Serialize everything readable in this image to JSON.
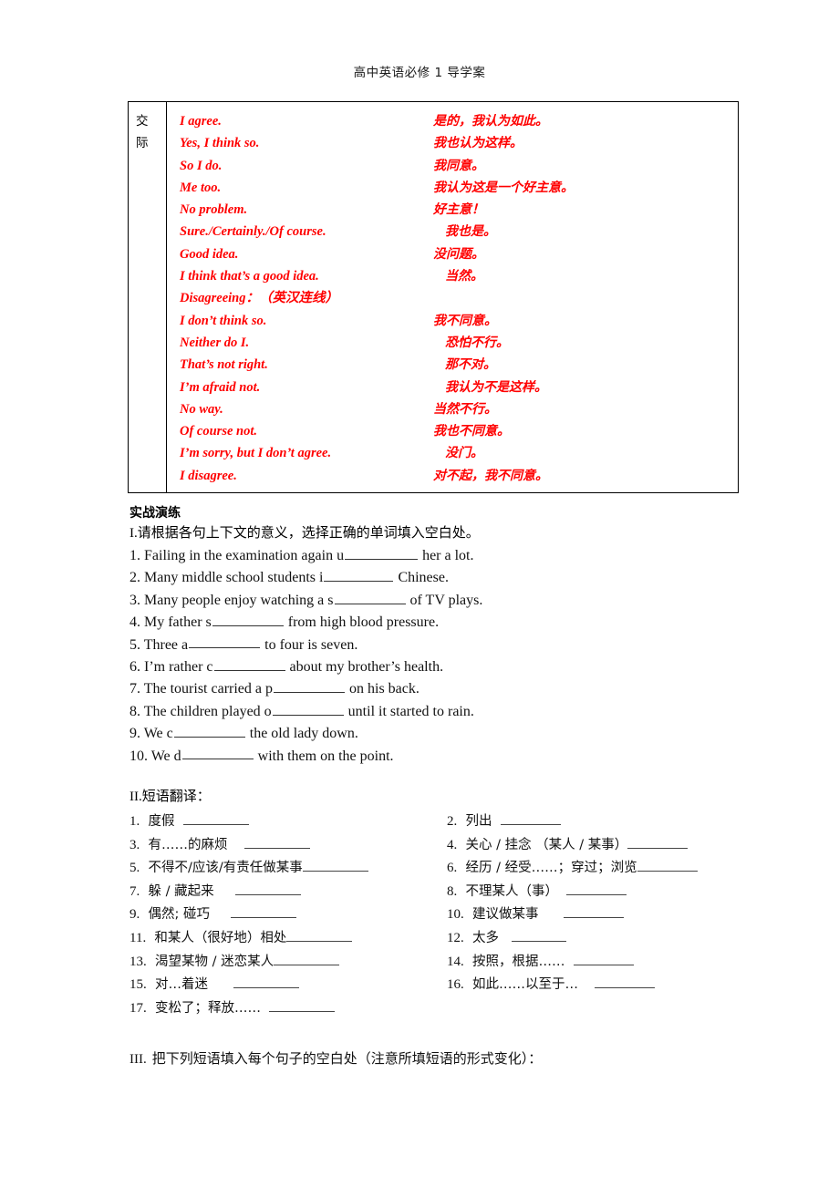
{
  "header": {
    "running_title": "高中英语必修 1 导学案"
  },
  "comm_table": {
    "row_label": [
      "交",
      "际"
    ],
    "rows": [
      {
        "en": "I agree.",
        "cn": "是的，我认为如此。",
        "cn_indent": false
      },
      {
        "en": "Yes, I think so.",
        "cn": "我也认为这样。",
        "cn_indent": false
      },
      {
        "en": "So I do.",
        "cn": "我同意。",
        "cn_indent": false
      },
      {
        "en": "Me too.",
        "cn": "我认为这是一个好主意。",
        "cn_indent": false
      },
      {
        "en": "No problem.",
        "cn": "好主意！",
        "cn_indent": false
      },
      {
        "en": "Sure./Certainly./Of course.",
        "cn": "我也是。",
        "cn_indent": true
      },
      {
        "en": "Good idea.",
        "cn": "没问题。",
        "cn_indent": false
      },
      {
        "en": "I think that’s a good idea.",
        "cn": "当然。",
        "cn_indent": true
      },
      {
        "en": "Disagreeing：（英汉连线）",
        "cn": "",
        "cn_indent": false
      },
      {
        "en": "I don’t think so.",
        "cn": "我不同意。",
        "cn_indent": false
      },
      {
        "en": "Neither do I.",
        "cn": "恐怕不行。",
        "cn_indent": true
      },
      {
        "en": "That’s not right.",
        "cn": "那不对。",
        "cn_indent": true
      },
      {
        "en": "I’m afraid not.",
        "cn": "我认为不是这样。",
        "cn_indent": true
      },
      {
        "en": "No way.",
        "cn": "当然不行。",
        "cn_indent": false
      },
      {
        "en": "Of course not.",
        "cn": "我也不同意。",
        "cn_indent": false
      },
      {
        "en": "I’m sorry, but I don’t agree.",
        "cn": "没门。",
        "cn_indent": true
      },
      {
        "en": "I disagree.",
        "cn": "对不起，我不同意。",
        "cn_indent": false
      }
    ]
  },
  "practice": {
    "heading": "实战演练",
    "section1_intro_num": "I.",
    "section1_intro": "请根据各句上下文的意义，选择正确的单词填入空白处。",
    "questions": [
      {
        "num": "1.",
        "before": "Failing in the examination again u",
        "after": "her a lot.",
        "blank": "b-w80"
      },
      {
        "num": "2.",
        "before": "Many middle school students i",
        "after": "Chinese.",
        "blank": "b-w76"
      },
      {
        "num": "3.",
        "before": "Many people enjoy watching a s",
        "after": "  of TV plays.",
        "blank": "b-w78"
      },
      {
        "num": "4.",
        "before": "My father s",
        "after": "from high blood pressure.",
        "blank": "b-w78"
      },
      {
        "num": "5.",
        "before": "Three a",
        "after": "to four is seven.",
        "blank": "b-w78"
      },
      {
        "num": "6.",
        "before": "I’m rather c",
        "after": "about my brother’s health.",
        "blank": "b-w78"
      },
      {
        "num": "7.",
        "before": "The tourist carried a p",
        "after": "on his back.",
        "blank": "b-w78"
      },
      {
        "num": "8.",
        "before": "The children played o",
        "after": "until it started to rain.",
        "blank": "b-w78"
      },
      {
        "num": "9.",
        "before": "We   c",
        "after": "the old lady down.",
        "blank": "b-w78"
      },
      {
        "num": "10.",
        "before": "We d",
        "after": "with them on the point.",
        "blank": "b-w78"
      }
    ]
  },
  "section2": {
    "num": "II.",
    "title": "短语翻译：",
    "rows": [
      {
        "left": {
          "num": "1.",
          "text": "度假",
          "gap": "  ",
          "blank": "pb-72"
        },
        "right": {
          "num": "2.",
          "text": "列出",
          "gap": "  ",
          "blank": "pb-66"
        }
      },
      {
        "left": {
          "num": "3.",
          "text": "有……的麻烦",
          "gap": "    ",
          "blank": "pb-72"
        },
        "right": {
          "num": "4.",
          "text": "关心 / 挂念 （某人 / 某事）",
          "gap": "",
          "blank": "pb-66"
        }
      },
      {
        "left": {
          "num": "5.",
          "text": "不得不/应该/有责任做某事",
          "gap": "",
          "blank": "pb-72"
        },
        "right": {
          "num": "6.",
          "text": "经历 / 经受……；穿过；浏览",
          "gap": "",
          "blank": "pb-66"
        }
      },
      {
        "left": {
          "num": "7.",
          "text": "躲 / 藏起来",
          "gap": "     ",
          "blank": "pb-72"
        },
        "right": {
          "num": "8.",
          "text": "不理某人（事）",
          "gap": "  ",
          "blank": "pb-66"
        }
      },
      {
        "left": {
          "num": "9.",
          "text": "偶然; 碰巧",
          "gap": "     ",
          "blank": "pb-72"
        },
        "right": {
          "num": "10.",
          "text": "建议做某事",
          "gap": "      ",
          "blank": "pb-66"
        }
      },
      {
        "left": {
          "num": "11.",
          "text": "和某人（很好地）相处",
          "gap": "",
          "blank": "pb-72"
        },
        "right": {
          "num": "12.",
          "text": "太多",
          "gap": "   ",
          "blank": "pb-60"
        }
      },
      {
        "left": {
          "num": "13.",
          "text": "渴望某物 / 迷恋某人",
          "gap": "",
          "blank": "pb-72"
        },
        "right": {
          "num": "14.",
          "text": "按照，根据……",
          "gap": "  ",
          "blank": "pb-66"
        }
      },
      {
        "left": {
          "num": "15.",
          "text": "对…着迷",
          "gap": "      ",
          "blank": "pb-72"
        },
        "right": {
          "num": "16.",
          "text": "如此……以至于…",
          "gap": "    ",
          "blank": "pb-66"
        }
      },
      {
        "left": {
          "num": "17.",
          "text": "变松了；释放……",
          "gap": "  ",
          "blank": "pb-72"
        },
        "right": null
      }
    ]
  },
  "section3": {
    "num": "III.",
    "text": "把下列短语填入每个句子的空白处（注意所填短语的形式变化）："
  },
  "colors": {
    "accent_red": "#ff0000",
    "text": "#111111",
    "border": "#000000"
  }
}
